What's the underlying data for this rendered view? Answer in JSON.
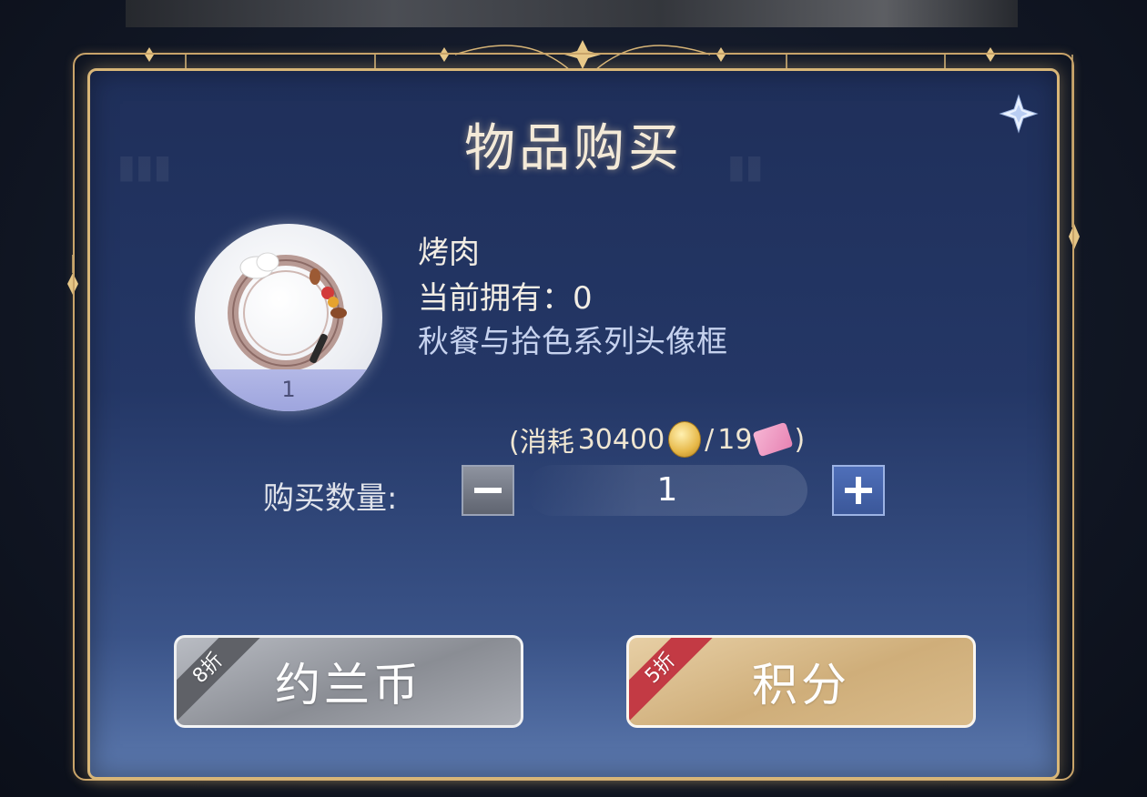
{
  "dialog": {
    "title": "物品购买",
    "close_icon": "close-star-icon"
  },
  "item": {
    "name": "烤肉",
    "owned_text": "当前拥有：0",
    "series": "秋餐与拾色系列头像框",
    "icon": "bbq-avatar-frame-icon",
    "quantity_badge": "1"
  },
  "cost": {
    "prefix": "(消耗",
    "coin_amount": "30400",
    "separator": "/",
    "points_amount": "19",
    "suffix": ")",
    "coin_icon": "gold-coin-icon",
    "points_icon": "pink-ticket-icon"
  },
  "quantity": {
    "label": "购买数量:",
    "value": "1",
    "minus_icon": "minus-icon",
    "plus_icon": "plus-icon"
  },
  "buttons": {
    "coin": {
      "label": "约兰币",
      "discount": "8折",
      "color": "#8a8d94"
    },
    "points": {
      "label": "积分",
      "discount": "5折",
      "color": "#cfae7a"
    }
  },
  "colors": {
    "frame_gold": "#d8b678",
    "panel_top": "#1f2f5a",
    "panel_bottom": "#5b78ad",
    "discount_red": "#c33a44"
  }
}
